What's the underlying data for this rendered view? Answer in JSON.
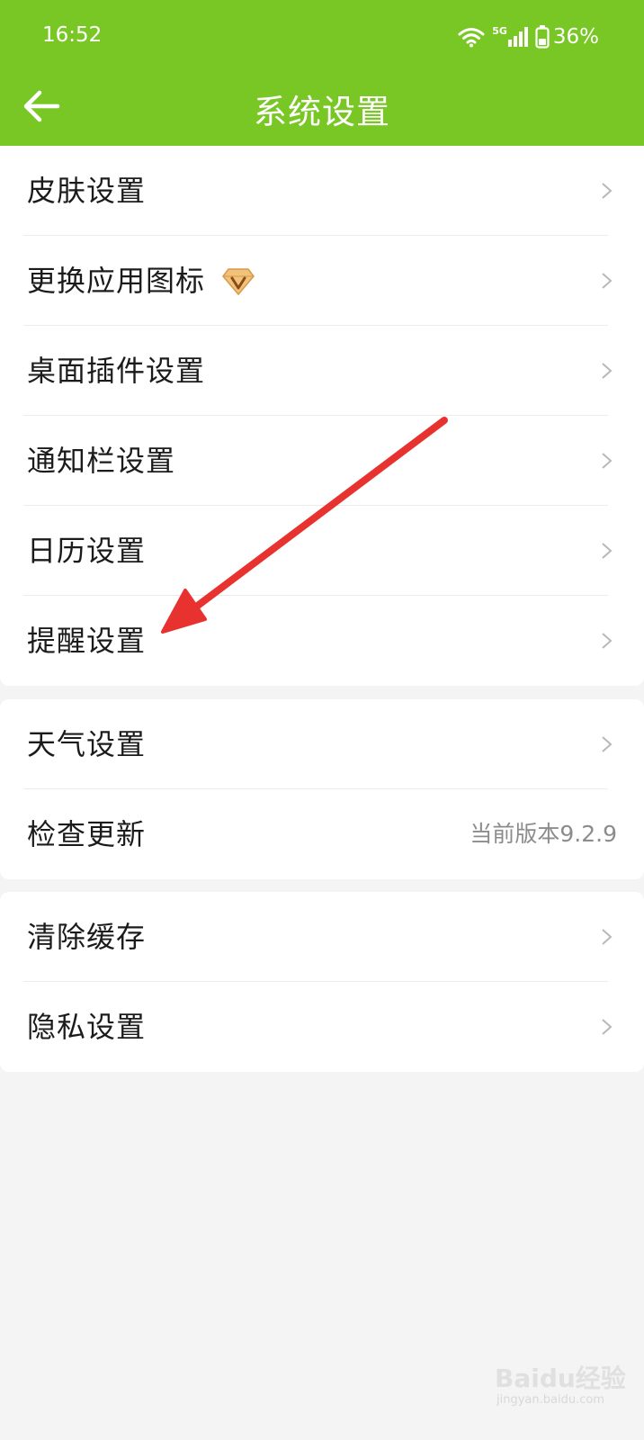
{
  "status_bar": {
    "time": "16:52",
    "network": "5G",
    "battery": "36%",
    "icons": [
      "wifi-icon",
      "signal-icon",
      "battery-icon"
    ]
  },
  "nav": {
    "title": "系统设置",
    "back_icon": "arrow-left-icon"
  },
  "groups": [
    {
      "items": [
        {
          "label": "皮肤设置"
        },
        {
          "label": "更换应用图标",
          "badge_icon": "diamond-vip-icon"
        },
        {
          "label": "桌面插件设置"
        },
        {
          "label": "通知栏设置"
        },
        {
          "label": "日历设置"
        },
        {
          "label": "提醒设置"
        }
      ]
    },
    {
      "items": [
        {
          "label": "天气设置"
        },
        {
          "label": "检查更新",
          "value": "当前版本9.2.9"
        }
      ]
    },
    {
      "items": [
        {
          "label": "清除缓存"
        },
        {
          "label": "隐私设置"
        }
      ]
    }
  ],
  "annotation": {
    "type": "arrow",
    "color": "#e8322f",
    "points_to": "提醒设置"
  },
  "watermark": {
    "main": "Baidu经验",
    "sub": "jingyan.baidu.com"
  },
  "colors": {
    "header": "#79c725",
    "background": "#f4f4f4",
    "text": "#1b1b1b",
    "secondary_text": "#8c8c8c"
  }
}
